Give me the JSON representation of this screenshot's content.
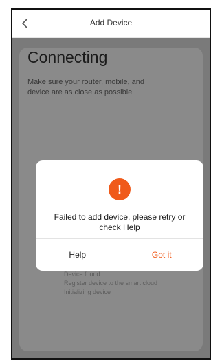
{
  "header": {
    "back_icon": "chevron-left-icon",
    "title": "Add Device"
  },
  "connecting": {
    "title": "Connecting",
    "description_lines": [
      "Make sure your router, mobile, and",
      "device are as close as possible"
    ]
  },
  "status": {
    "lines": [
      "Device found",
      "Register device to the smart cloud",
      "Initializing device"
    ]
  },
  "dialog": {
    "icon": "exclamation-alert-icon",
    "icon_color": "#f05a1a",
    "message_lines": [
      "Failed to add device, please retry or",
      "check Help"
    ],
    "help_label": "Help",
    "got_it_label": "Got it",
    "accent_color": "#f05a1a"
  }
}
